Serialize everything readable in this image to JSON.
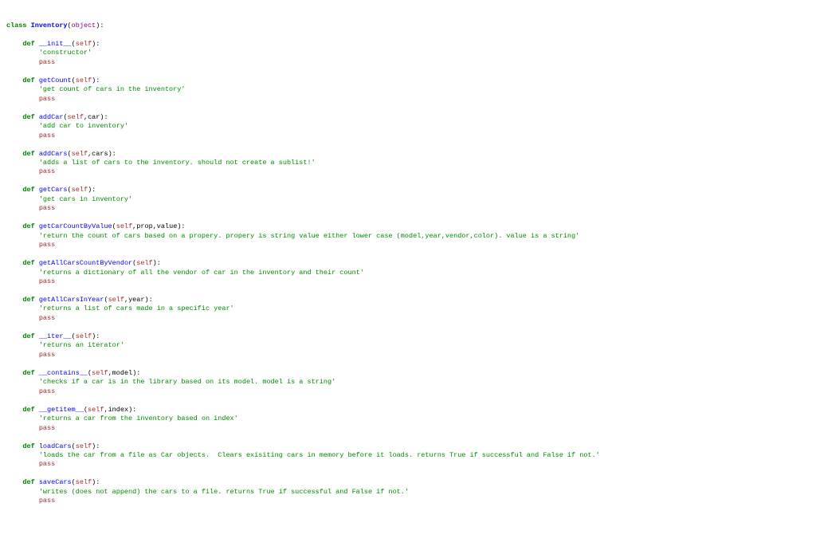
{
  "code": {
    "class_kw": "class",
    "class_name": "Inventory",
    "base": "object",
    "def_kw": "def",
    "self": "self",
    "pass": "pass",
    "methods": [
      {
        "name": "__init__",
        "params": "self",
        "doc": "'constructor'"
      },
      {
        "name": "getCount",
        "params": "self",
        "doc": "'get count of cars in the inventory'"
      },
      {
        "name": "addCar",
        "params": "self,car",
        "doc": "'add car to inventory'"
      },
      {
        "name": "addCars",
        "params": "self,cars",
        "doc": "'adds a list of cars to the inventory. should not create a sublist!'"
      },
      {
        "name": "getCars",
        "params": "self",
        "doc": "'get cars in inventory'"
      },
      {
        "name": "getCarCountByValue",
        "params": "self,prop, value",
        "doc": "'return the count of cars based on a propery. propery is string value either lower case (model,year,vendor,color). value is a string'"
      },
      {
        "name": "getAllCarsCountByVendor",
        "params": "self",
        "doc": "'returns a dictionary of all the vendor of car in the inventory and their count'"
      },
      {
        "name": "getAllCarsInYear",
        "params": "self,year",
        "doc": "'returns a list of cars made in a specific year'"
      },
      {
        "name": "__iter__",
        "params": "self",
        "doc": "'returns an iterator'"
      },
      {
        "name": "__contains__",
        "params": "self,model",
        "doc": "'checks if a car is in the library based on its model. model is a string'"
      },
      {
        "name": "__getitem__",
        "params": "self,index",
        "doc": "'returns a car from the inventory based on index'"
      },
      {
        "name": "loadCars",
        "params": "self",
        "doc": "'loads the car from a file as Car objects.  Clears exisiting cars in memory before it loads. returns True if successful and False if not.'"
      },
      {
        "name": "saveCars",
        "params": "self",
        "doc": "'writes (does not append) the cars to a file. returns True if successful and False if not.'"
      }
    ]
  }
}
